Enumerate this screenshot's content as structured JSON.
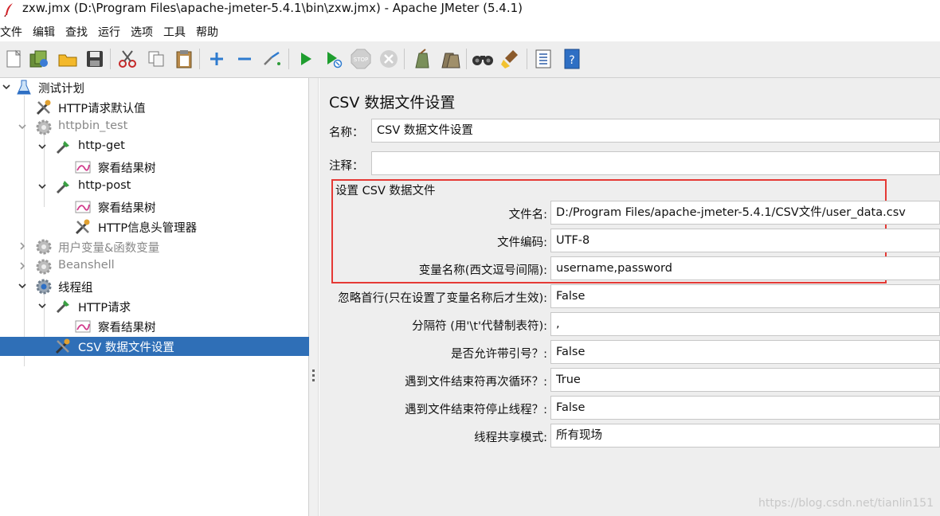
{
  "window": {
    "title": "zxw.jmx (D:\\Program Files\\apache-jmeter-5.4.1\\bin\\zxw.jmx) - Apache JMeter (5.4.1)"
  },
  "menu": [
    "文件",
    "编辑",
    "查找",
    "运行",
    "选项",
    "工具",
    "帮助"
  ],
  "toolbar": {
    "icons": [
      "new-icon",
      "templates-icon",
      "open-icon",
      "save-icon",
      "cut-icon",
      "copy-icon",
      "paste-icon",
      "expand-icon",
      "collapse-icon",
      "toggle-icon",
      "start-icon",
      "start-no-pause-icon",
      "stop-icon",
      "shutdown-icon",
      "clear-icon",
      "clear-all-icon",
      "search-icon",
      "reset-search-icon",
      "function-helper-icon",
      "help-icon"
    ]
  },
  "tree": {
    "items": [
      {
        "label": "测试计划",
        "icon": "test-plan-icon",
        "expanded": true
      },
      {
        "label": "HTTP请求默认值",
        "icon": "config-element-icon"
      },
      {
        "label": "httpbin_test",
        "icon": "thread-group-icon",
        "disabled": true,
        "expanded": true
      },
      {
        "label": "http-get",
        "icon": "sampler-icon",
        "expanded": true
      },
      {
        "label": "察看结果树",
        "icon": "listener-icon"
      },
      {
        "label": "http-post",
        "icon": "sampler-icon",
        "expanded": true
      },
      {
        "label": "察看结果树",
        "icon": "listener-icon"
      },
      {
        "label": "HTTP信息头管理器",
        "icon": "config-element-icon"
      },
      {
        "label": "用户变量&函数变量",
        "icon": "thread-group-icon",
        "disabled": true,
        "expanded": false
      },
      {
        "label": "Beanshell",
        "icon": "thread-group-icon",
        "disabled": true,
        "expanded": false
      },
      {
        "label": "线程组",
        "icon": "thread-group-icon",
        "expanded": true
      },
      {
        "label": "HTTP请求",
        "icon": "sampler-icon",
        "expanded": true
      },
      {
        "label": "察看结果树",
        "icon": "listener-icon"
      },
      {
        "label": "CSV 数据文件设置",
        "icon": "config-element-icon",
        "selected": true
      }
    ]
  },
  "panel": {
    "title": "CSV 数据文件设置",
    "name_label": "名称：",
    "name_value": "CSV 数据文件设置",
    "comment_label": "注释：",
    "comment_value": "",
    "group_title": "设置 CSV 数据文件",
    "fields": [
      {
        "label": "文件名:",
        "value": "D:/Program Files/apache-jmeter-5.4.1/CSV文件/user_data.csv"
      },
      {
        "label": "文件编码:",
        "value": "UTF-8"
      },
      {
        "label": "变量名称(西文逗号间隔):",
        "value": "username,password"
      },
      {
        "label": "忽略首行(只在设置了变量名称后才生效):",
        "value": "False"
      },
      {
        "label": "分隔符 (用'\\t'代替制表符):",
        "value": ","
      },
      {
        "label": "是否允许带引号？:",
        "value": "False"
      },
      {
        "label": "遇到文件结束符再次循环？:",
        "value": "True"
      },
      {
        "label": "遇到文件结束符停止线程？:",
        "value": "False"
      },
      {
        "label": "线程共享模式:",
        "value": "所有现场"
      }
    ]
  },
  "watermark": "https://blog.csdn.net/tianlin151",
  "colors": {
    "selection": "#2f6fb7",
    "highlight_box": "#e53935",
    "panel_bg": "#eeeeee"
  }
}
